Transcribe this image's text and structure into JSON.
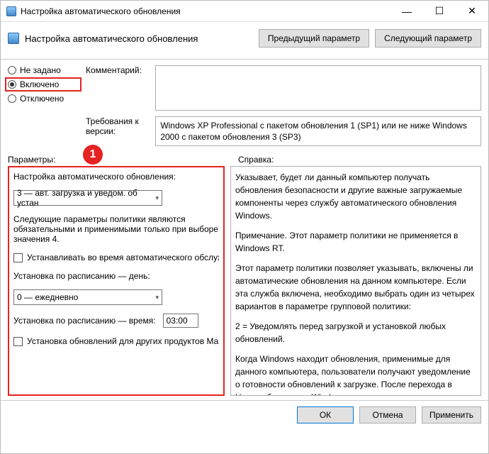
{
  "window": {
    "title": "Настройка автоматического обновления"
  },
  "header": {
    "title": "Настройка автоматического обновления",
    "prev_button": "Предыдущий параметр",
    "next_button": "Следующий параметр"
  },
  "state": {
    "not_configured": "Не задано",
    "enabled": "Включено",
    "disabled": "Отключено",
    "selected": "enabled"
  },
  "labels": {
    "comment": "Комментарий:",
    "supported": "Требования к версии:",
    "options": "Параметры:",
    "help": "Справка:"
  },
  "comment_value": "",
  "supported_text": "Windows XP Professional с пакетом обновления 1 (SP1) или не ниже Windows 2000 с пакетом обновления 3 (SP3)",
  "options": {
    "heading": "Настройка автоматического обновления:",
    "mode_value": "3 — авт. загрузка и уведом. об устан",
    "note1": "Следующие параметры политики являются обязательными и применимыми только при выборе значения 4.",
    "check_maintenance": "Устанавливать во время автоматического обслуживания",
    "day_label": "Установка по расписанию — день:",
    "day_value": "0 — ежедневно",
    "time_label": "Установка по расписанию — время:",
    "time_value": "03:00",
    "check_other_products": "Установка обновлений для других продуктов Майкрософт"
  },
  "help_text": {
    "p1": "Указывает, будет ли данный компьютер получать обновления безопасности и другие важные загружаемые компоненты через службу автоматического обновления Windows.",
    "p2": "Примечание. Этот параметр политики не применяется в Windows RT.",
    "p3": "Этот параметр политики позволяет указывать, включены ли автоматические обновления на данном компьютере. Если эта служба включена, необходимо выбрать один из четырех вариантов в параметре групповой политики:",
    "p4": "    2 = Уведомлять перед загрузкой и установкой любых обновлений.",
    "p5": "    Когда Windows находит обновления, применимые для данного компьютера, пользователи получают уведомление о готовности обновлений к загрузке. После перехода в Центр обновления Windows пользователи могут загрузить и"
  },
  "footer": {
    "ok": "ОК",
    "cancel": "Отмена",
    "apply": "Применить"
  },
  "badge1": "1"
}
